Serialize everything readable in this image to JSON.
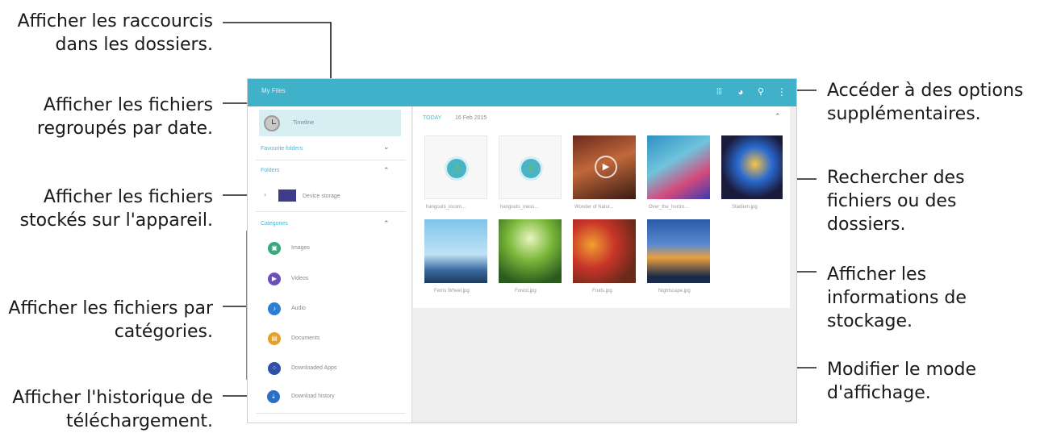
{
  "annotations": {
    "left": [
      {
        "lines": [
          "Afficher les raccourcis",
          "dans les dossiers."
        ]
      },
      {
        "lines": [
          "Afficher les fichiers",
          "regroupés par date."
        ]
      },
      {
        "lines": [
          "Afficher les fichiers",
          "stockés sur l'appareil."
        ]
      },
      {
        "lines": [
          "Afficher les fichiers par",
          "catégories."
        ]
      },
      {
        "lines": [
          "Afficher l'historique de",
          "téléchargement."
        ]
      }
    ],
    "right": [
      {
        "lines": [
          "Accéder à des options",
          "supplémentaires."
        ]
      },
      {
        "lines": [
          "Rechercher des",
          "fichiers ou des",
          "dossiers."
        ]
      },
      {
        "lines": [
          "Afficher les",
          "informations de",
          "stockage."
        ]
      },
      {
        "lines": [
          "Modifier le mode",
          "d'affichage."
        ]
      }
    ]
  },
  "app": {
    "title": "My Files",
    "icons": [
      "grid-view-icon",
      "storage-pie-icon",
      "search-icon",
      "more-options-icon"
    ],
    "accent": "#3fb1c8"
  },
  "sidebar": {
    "timeline": "Timeline",
    "favourite_folders": "Favourite folders",
    "folders": "Folders",
    "device_storage": "Device storage",
    "categories_header": "Categories",
    "categories": [
      {
        "label": "Images",
        "icon": "image-icon",
        "color": "#3aaa7a"
      },
      {
        "label": "Videos",
        "icon": "video-icon",
        "color": "#6b4fbb"
      },
      {
        "label": "Audio",
        "icon": "music-icon",
        "color": "#2a7fd4"
      },
      {
        "label": "Documents",
        "icon": "document-icon",
        "color": "#e3a02a"
      },
      {
        "label": "Downloaded Apps",
        "icon": "apps-icon",
        "color": "#2f4fa8"
      }
    ],
    "download_history": "Download history"
  },
  "content": {
    "today": "TODAY",
    "date": "16 Feb 2015",
    "files": [
      "hangouts_incom...",
      "hangouts_mess...",
      "Wonder of Natur...",
      "Over_the_horizo...",
      "Stadium.jpg",
      "Ferris Wheel.jpg",
      "Forest.jpg",
      "Fruits.jpg",
      "Nightscape.jpg"
    ]
  }
}
